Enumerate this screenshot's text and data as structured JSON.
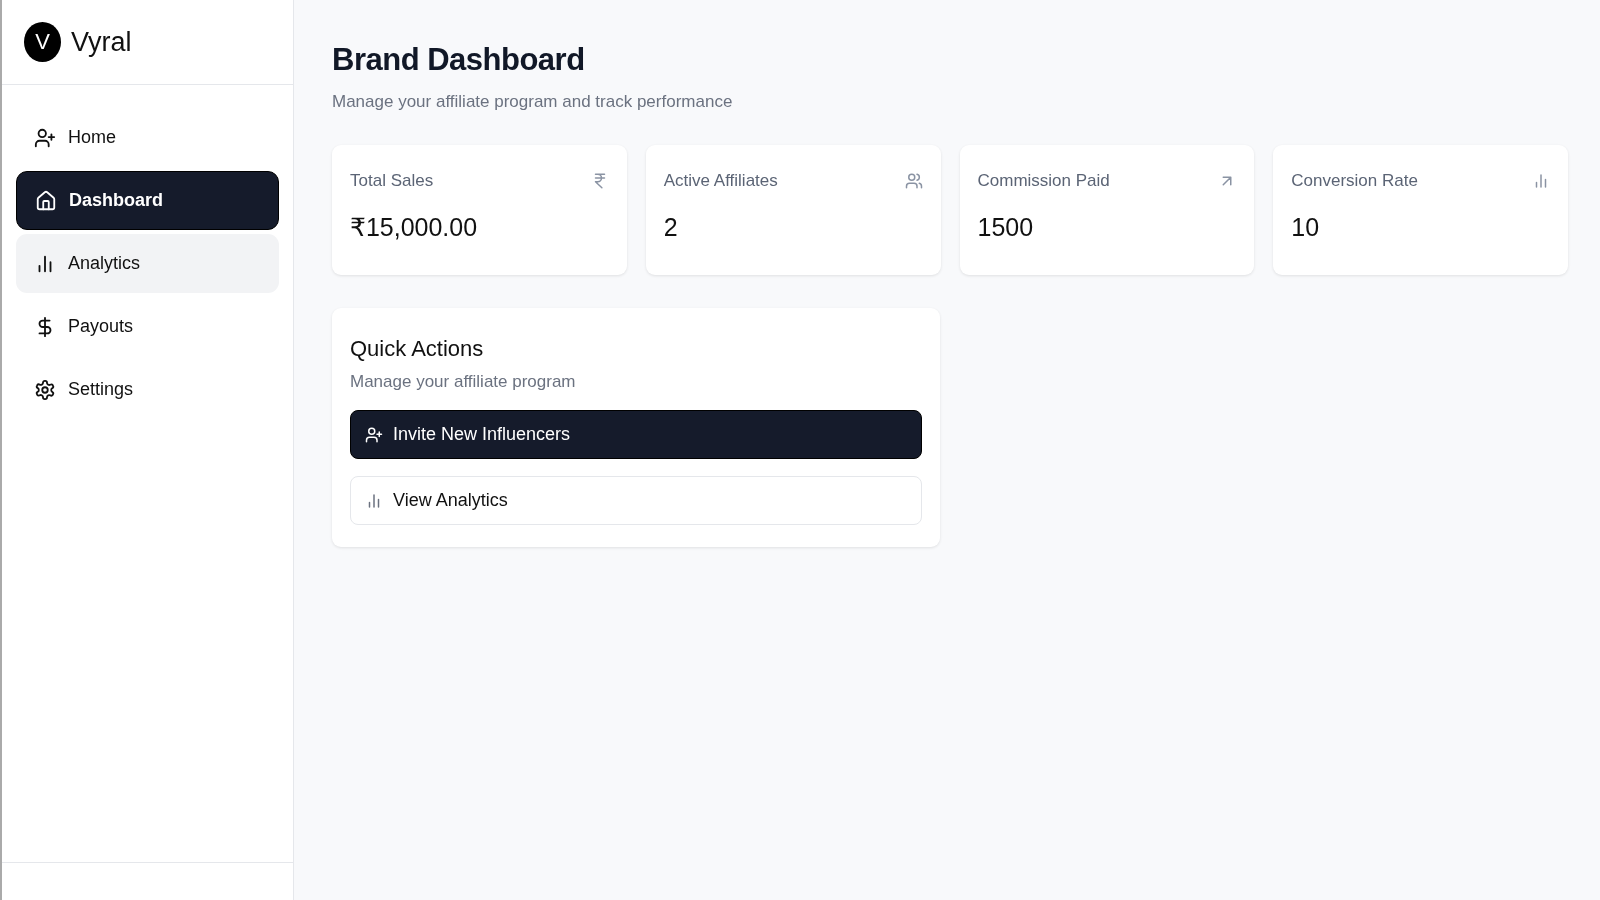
{
  "brand": {
    "initial": "V",
    "name": "Vyral"
  },
  "nav": [
    {
      "label": "Home",
      "selected": false,
      "hovered": false
    },
    {
      "label": "Dashboard",
      "selected": true,
      "hovered": false
    },
    {
      "label": "Analytics",
      "selected": false,
      "hovered": true
    },
    {
      "label": "Payouts",
      "selected": false,
      "hovered": false
    },
    {
      "label": "Settings",
      "selected": false,
      "hovered": false
    }
  ],
  "header": {
    "title": "Brand Dashboard",
    "subtitle": "Manage your affiliate program and track performance"
  },
  "stats": [
    {
      "label": "Total Sales",
      "value": "₹15,000.00"
    },
    {
      "label": "Active Affiliates",
      "value": "2"
    },
    {
      "label": "Commission Paid",
      "value": "1500"
    },
    {
      "label": "Conversion Rate",
      "value": "10"
    }
  ],
  "quick_actions": {
    "title": "Quick Actions",
    "subtitle": "Manage your affiliate program",
    "actions": [
      {
        "label": "Invite New Influencers",
        "kind": "primary"
      },
      {
        "label": "View Analytics",
        "kind": "outline"
      }
    ]
  }
}
